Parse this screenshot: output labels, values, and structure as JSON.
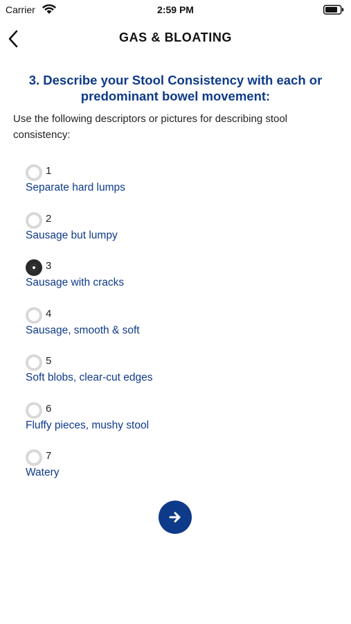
{
  "status": {
    "carrier": "Carrier",
    "time": "2:59 PM"
  },
  "nav": {
    "title": "GAS & BLOATING"
  },
  "question": {
    "title": "3. Describe your Stool Consistency with each or predominant bowel movement:",
    "instructions": "Use the following descriptors or pictures for describing stool consistency:"
  },
  "options": [
    {
      "number": "1",
      "label": "Separate hard lumps",
      "selected": false
    },
    {
      "number": "2",
      "label": "Sausage but lumpy",
      "selected": false
    },
    {
      "number": "3",
      "label": "Sausage with cracks",
      "selected": true
    },
    {
      "number": "4",
      "label": "Sausage, smooth & soft",
      "selected": false
    },
    {
      "number": "5",
      "label": "Soft blobs, clear-cut edges",
      "selected": false
    },
    {
      "number": "6",
      "label": "Fluffy pieces, mushy stool",
      "selected": false
    },
    {
      "number": "7",
      "label": "Watery",
      "selected": false
    }
  ],
  "icons": {
    "back": "chevron-left-icon",
    "next": "arrow-right-icon",
    "wifi": "wifi-icon",
    "battery": "battery-icon"
  },
  "colors": {
    "accent": "#0e3a8a",
    "radio_unselected": "#d8d8d8",
    "radio_selected": "#2b2b2b"
  }
}
